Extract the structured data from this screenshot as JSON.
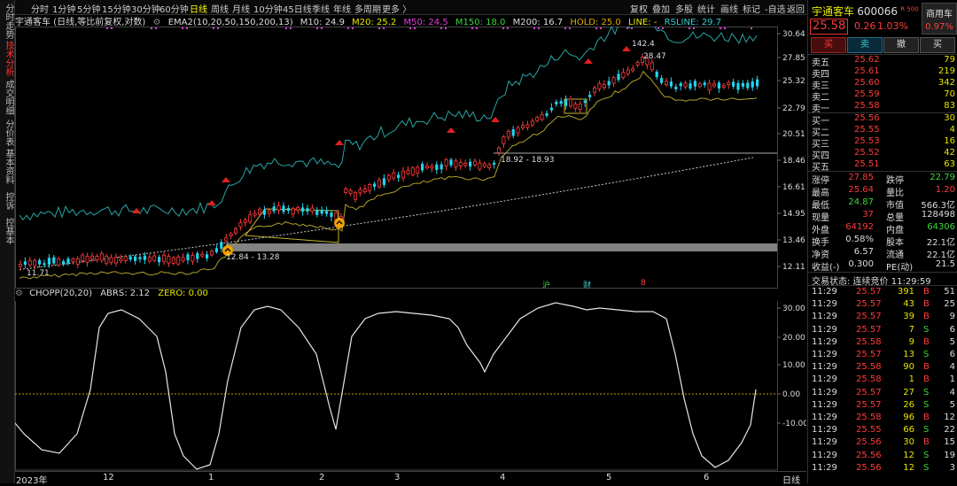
{
  "left_tabs": [
    {
      "label": "分时走势",
      "active": false
    },
    {
      "label": "技术分析",
      "active": true
    },
    {
      "label": "成交明细",
      "active": false
    },
    {
      "label": "分价表",
      "active": false
    },
    {
      "label": "基本资料",
      "active": false
    },
    {
      "label": "控诉",
      "active": false
    },
    {
      "label": "控基本",
      "active": false
    }
  ],
  "toolbar": {
    "periods": [
      "分时",
      "1分钟",
      "5分钟",
      "15分钟",
      "30分钟",
      "60分钟",
      "日线",
      "周线",
      "月线",
      "10分钟",
      "45日线",
      "季线",
      "年线",
      "多周期",
      "更多 〉"
    ],
    "active_period": "日线",
    "right_buttons": [
      "复权",
      "叠加",
      "多股",
      "统计",
      "画线",
      "标记",
      "-自选",
      "返回"
    ]
  },
  "infoline": {
    "title": "宇通客车 (日线,等比前复权,对数)",
    "ema_label": "EMA2(10,20,50,150,200,13)",
    "m10": "M10: 24.9",
    "m20": "M20: 25.2",
    "m50": "M50: 24.5",
    "m150": "M150: 18.0",
    "m200": "M200: 16.7",
    "hold": "HOLD: 25.0",
    "line": "LINE: -",
    "rsline": "RSLINE: 29.7"
  },
  "colors": {
    "m10": "#ddd",
    "m20": "#e6e600",
    "m50": "#e040e0",
    "m150": "#3cd63c",
    "m200": "#ddd",
    "hold": "#e6a800",
    "line": "#e6e600",
    "rsline": "#3cc"
  },
  "price_axis": [
    "30.64",
    "27.85",
    "25.32",
    "22.79",
    "20.51",
    "18.46",
    "16.61",
    "14.95",
    "13.46",
    "12.11"
  ],
  "annotations": {
    "high": "142.4",
    "high2": "28.47",
    "zone1": "18.92 - 18.93",
    "zone2": "12.84 - 13.28",
    "low": "11.71"
  },
  "event_marks": [
    "沪",
    "财",
    "8"
  ],
  "sub_indicator": {
    "title": "CHOPP(20,20)",
    "abrs": "ABRS: 2.12",
    "zero": "ZERO: 0.00"
  },
  "sub_axis": [
    "30.00",
    "20.00",
    "10.00",
    "0.00",
    "-10.00"
  ],
  "x_axis": [
    "2023年",
    "12",
    "1",
    "2",
    "3",
    "4",
    "5",
    "6"
  ],
  "period_label": "日线",
  "stock": {
    "name": "宇通客车",
    "code": "600066",
    "tag": "R 500",
    "sector": "商用车",
    "sector_pct": "0.97%",
    "price": "25.58",
    "change": "0.26",
    "pct": "1.03%"
  },
  "actions": [
    "买",
    "卖",
    "撤",
    "买"
  ],
  "asks": [
    {
      "label": "卖五",
      "price": "25.62",
      "vol": "79"
    },
    {
      "label": "卖四",
      "price": "25.61",
      "vol": "219"
    },
    {
      "label": "卖三",
      "price": "25.60",
      "vol": "342"
    },
    {
      "label": "卖二",
      "price": "25.59",
      "vol": "70"
    },
    {
      "label": "卖一",
      "price": "25.58",
      "vol": "83"
    }
  ],
  "bids": [
    {
      "label": "买一",
      "price": "25.56",
      "vol": "30"
    },
    {
      "label": "买二",
      "price": "25.55",
      "vol": "4"
    },
    {
      "label": "买三",
      "price": "25.53",
      "vol": "16"
    },
    {
      "label": "买四",
      "price": "25.52",
      "vol": "42"
    },
    {
      "label": "买五",
      "price": "25.51",
      "vol": "63"
    }
  ],
  "stats": [
    {
      "k1": "涨停",
      "v1": "27.85",
      "k2": "跌停",
      "v2": "22.79",
      "c1": "red",
      "c2": "green"
    },
    {
      "k1": "最高",
      "v1": "25.64",
      "k2": "量比",
      "v2": "1.20",
      "c1": "red",
      "c2": "red"
    },
    {
      "k1": "最低",
      "v1": "24.87",
      "k2": "市值",
      "v2": "566.3亿",
      "c1": "green",
      "c2": "white"
    },
    {
      "k1": "现量",
      "v1": "37",
      "k2": "总量",
      "v2": "128498",
      "c1": "red",
      "c2": "white"
    },
    {
      "k1": "外盘",
      "v1": "64192",
      "k2": "内盘",
      "v2": "64306",
      "c1": "red",
      "c2": "green"
    },
    {
      "k1": "换手",
      "v1": "0.58%",
      "k2": "股本",
      "v2": "22.1亿",
      "c1": "white",
      "c2": "white"
    },
    {
      "k1": "净资",
      "v1": "6.57",
      "k2": "流通",
      "v2": "22.1亿",
      "c1": "white",
      "c2": "white"
    },
    {
      "k1": "收益(-)",
      "v1": "0.300",
      "k2": "PE(动)",
      "v2": "21.5",
      "c1": "white",
      "c2": "white"
    }
  ],
  "trade_status": "交易状态: 连续竞价 11:29:59",
  "ticks": [
    {
      "t": "11:29",
      "p": "25.57",
      "v": "391",
      "d": "B",
      "n": "51"
    },
    {
      "t": "11:29",
      "p": "25.57",
      "v": "43",
      "d": "B",
      "n": "25"
    },
    {
      "t": "11:29",
      "p": "25.57",
      "v": "39",
      "d": "B",
      "n": "9"
    },
    {
      "t": "11:29",
      "p": "25.57",
      "v": "7",
      "d": "S",
      "n": "6"
    },
    {
      "t": "11:29",
      "p": "25.58",
      "v": "9",
      "d": "B",
      "n": "5"
    },
    {
      "t": "11:29",
      "p": "25.57",
      "v": "13",
      "d": "S",
      "n": "6"
    },
    {
      "t": "11:29",
      "p": "25.58",
      "v": "90",
      "d": "B",
      "n": "4"
    },
    {
      "t": "11:29",
      "p": "25.58",
      "v": "1",
      "d": "B",
      "n": "1"
    },
    {
      "t": "11:29",
      "p": "25.57",
      "v": "27",
      "d": "S",
      "n": "4"
    },
    {
      "t": "11:29",
      "p": "25.57",
      "v": "26",
      "d": "S",
      "n": "5"
    },
    {
      "t": "11:29",
      "p": "25.58",
      "v": "96",
      "d": "B",
      "n": "12"
    },
    {
      "t": "11:29",
      "p": "25.55",
      "v": "66",
      "d": "S",
      "n": "22"
    },
    {
      "t": "11:29",
      "p": "25.56",
      "v": "30",
      "d": "B",
      "n": "15"
    },
    {
      "t": "11:29",
      "p": "25.56",
      "v": "12",
      "d": "S",
      "n": "19"
    },
    {
      "t": "11:29",
      "p": "25.56",
      "v": "12",
      "d": "S",
      "n": "3"
    }
  ]
}
